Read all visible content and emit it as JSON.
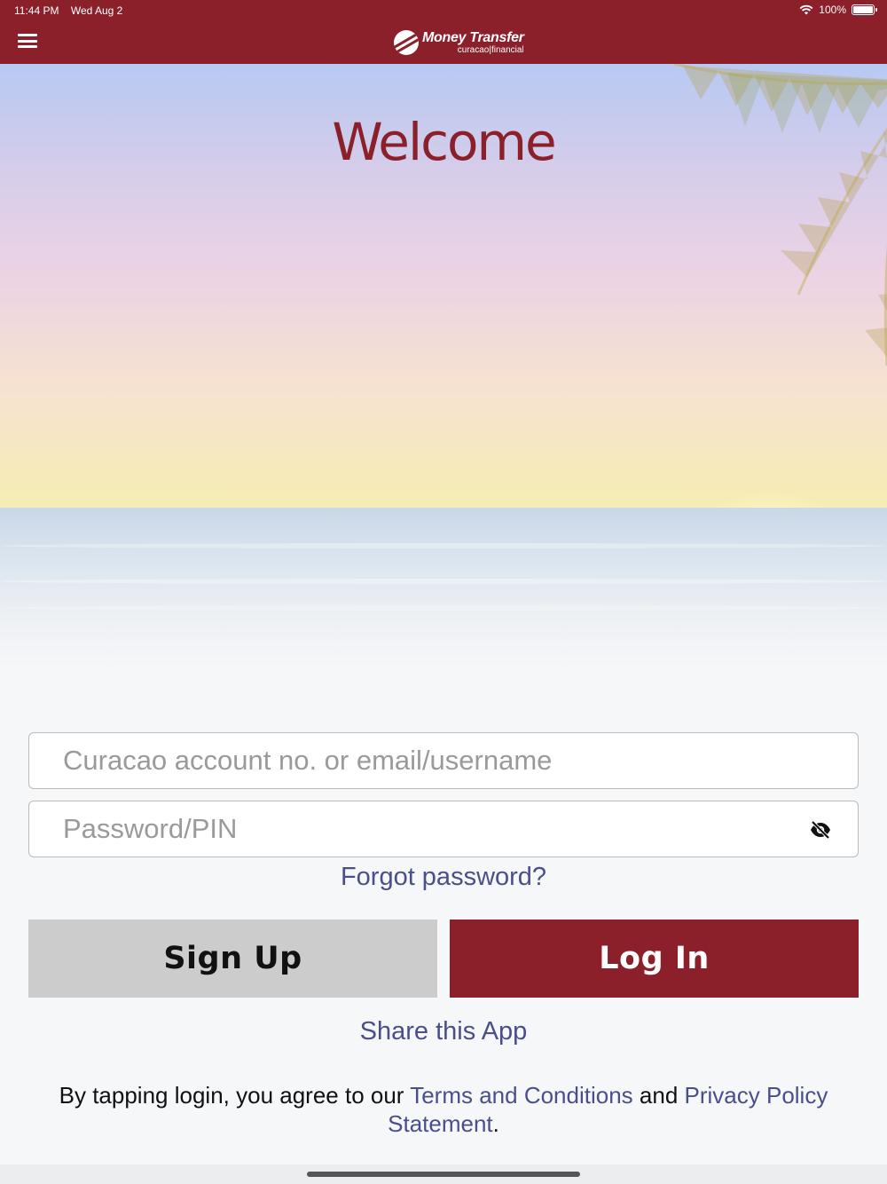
{
  "status_bar": {
    "time": "11:44 PM",
    "date": "Wed Aug 2",
    "battery": "100%",
    "battery_level": 1.0,
    "wifi_icon": "wifi-icon",
    "battery_icon": "battery-icon"
  },
  "header": {
    "menu_icon": "hamburger-menu-icon",
    "logo_title": "Money Transfer",
    "logo_subtitle": "curacao|financial",
    "background_color": "#8b1f2a"
  },
  "hero": {
    "welcome": "Welcome"
  },
  "form": {
    "username_placeholder": "Curacao account no. or email/username",
    "username_value": "",
    "password_placeholder": "Password/PIN",
    "password_value": "",
    "password_toggle_icon": "eye-slash-icon",
    "forgot_password": "Forgot password?"
  },
  "buttons": {
    "signup_label": "Sign Up",
    "login_label": "Log In"
  },
  "share_label": "Share this App",
  "terms": {
    "prefix": "By tapping login, you agree to our ",
    "terms_link": "Terms and Conditions",
    "middle": " and ",
    "privacy_link": "Privacy Policy Statement",
    "suffix": "."
  },
  "colors": {
    "brand": "#8b1f2a",
    "link": "#4a4f8c",
    "secondary_button": "#cccccc"
  }
}
